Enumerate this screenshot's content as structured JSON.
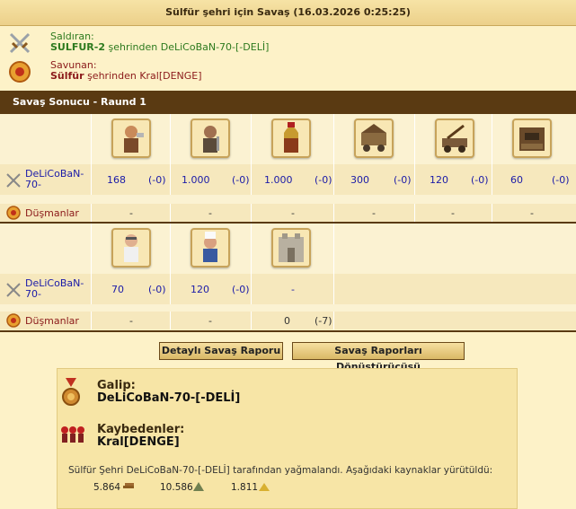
{
  "window": {
    "title": "Sülfür şehri için Savaş (16.03.2026 0:25:25)"
  },
  "attacker": {
    "label": "Saldıran:",
    "city_bold": "SULFUR-2",
    "rest": " şehrinden DeLiCoBaN-70-[-DELİ]"
  },
  "defender": {
    "label": "Savunan:",
    "city_bold": "Sülfür",
    "rest": " şehrinden Kral[DENGE]"
  },
  "section": {
    "title": "Savaş Sonucu - Raund 1"
  },
  "round1": {
    "units": [
      "hoplite-icon",
      "swordsman-icon",
      "spartan-icon",
      "ram-icon",
      "catapult-icon",
      "mortar-icon"
    ],
    "player": "DeLiCoBaN-70-",
    "values": [
      {
        "n": "168",
        "l": "(-0)"
      },
      {
        "n": "1.000",
        "l": "(-0)"
      },
      {
        "n": "1.000",
        "l": "(-0)"
      },
      {
        "n": "300",
        "l": "(-0)"
      },
      {
        "n": "120",
        "l": "(-0)"
      },
      {
        "n": "60",
        "l": "(-0)"
      }
    ],
    "enemies_label": "Düşmanlar",
    "enemy_values": [
      "-",
      "-",
      "-",
      "-",
      "-",
      "-"
    ]
  },
  "round2": {
    "units": [
      "doctor-icon",
      "cook-icon",
      "wall-icon"
    ],
    "player": "DeLiCoBaN-70-",
    "values": [
      {
        "n": "70",
        "l": "(-0)"
      },
      {
        "n": "120",
        "l": "(-0)"
      },
      {
        "n": "-",
        "l": ""
      }
    ],
    "enemies_label": "Düşmanlar",
    "enemy_values": [
      "-",
      "-"
    ],
    "enemy_wall": {
      "n": "0",
      "l": "(-7)"
    }
  },
  "buttons": {
    "detailed": "Detaylı Savaş Raporu",
    "converter": "Savaş Raporları Dönüştürücüsü"
  },
  "result": {
    "winner_label": "Galip:",
    "winner": "DeLiCoBaN-70-[-DELİ]",
    "losers_label": "Kaybedenler:",
    "losers": "Kral[DENGE]",
    "plunder_text": "Sülfür Şehri DeLiCoBaN-70-[-DELİ] tarafından yağmalandı. Aşağıdaki kaynaklar yürütüldü:",
    "resources": [
      {
        "amount": "5.864",
        "icon": "wood-icon"
      },
      {
        "amount": "10.586",
        "icon": "marble-icon"
      },
      {
        "amount": "1.811",
        "icon": "sulfur-icon"
      }
    ]
  },
  "colors": {
    "header_brown": "#5a3a12",
    "bg": "#fdf2c8",
    "link_blue": "#1a1aa8",
    "attacker_green": "#2d7a1e",
    "defender_red": "#8b1a1a"
  }
}
